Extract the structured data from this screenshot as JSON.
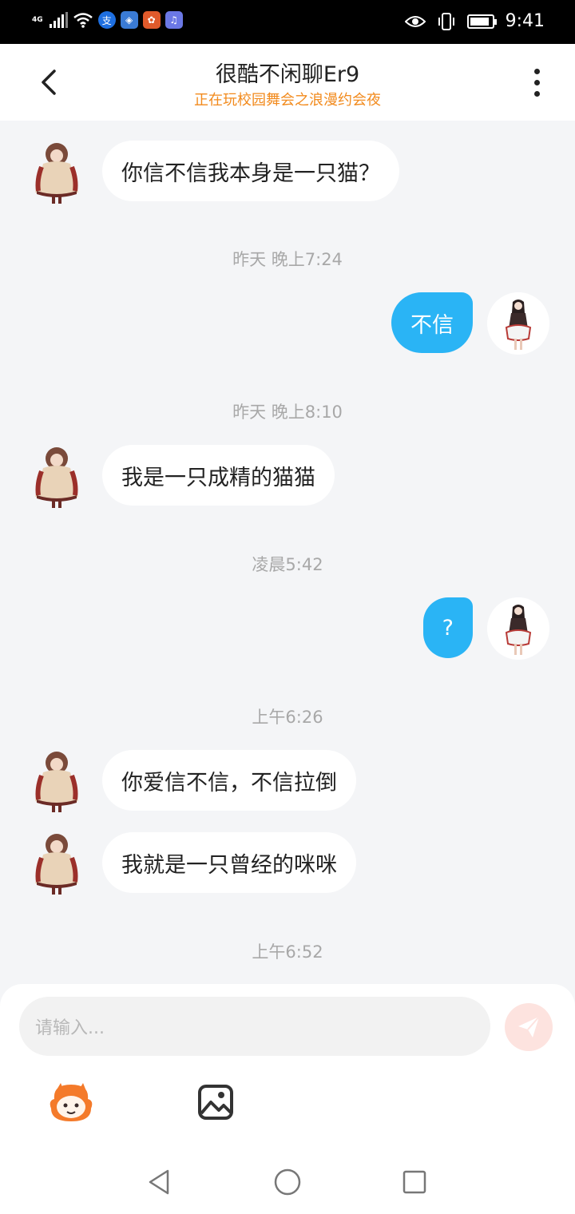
{
  "status_bar": {
    "network": "4G",
    "time": "9:41",
    "battery_level": 0.9
  },
  "header": {
    "title": "很酷不闲聊Er9",
    "subtitle": "正在玩校园舞会之浪漫约会夜",
    "subtitle_color": "#f28a1c"
  },
  "messages": [
    {
      "side": "left",
      "text": "你信不信我本身是一只猫？"
    },
    {
      "type": "timestamp",
      "text": "昨天 晚上7:24"
    },
    {
      "side": "right",
      "text": "不信"
    },
    {
      "type": "timestamp",
      "text": "昨天 晚上8:10"
    },
    {
      "side": "left",
      "text": "我是一只成精的猫猫"
    },
    {
      "type": "timestamp",
      "text": "凌晨5:42"
    },
    {
      "side": "right",
      "text": "?"
    },
    {
      "type": "timestamp",
      "text": "上午6:26"
    },
    {
      "side": "left",
      "text": "你爱信不信，不信拉倒"
    },
    {
      "side": "left",
      "text": "我就是一只曾经的咪咪"
    },
    {
      "type": "timestamp",
      "text": "上午6:52"
    }
  ],
  "input": {
    "placeholder": "请输入..."
  },
  "colors": {
    "outgoing_bubble": "#2ab4f5",
    "incoming_bubble": "#ffffff",
    "send_button": "#fde3df"
  },
  "icons": {
    "back": "chevron-left-icon",
    "more": "more-vertical-icon",
    "send": "paper-plane-icon",
    "sticker": "sticker-face-icon",
    "image": "image-icon"
  }
}
